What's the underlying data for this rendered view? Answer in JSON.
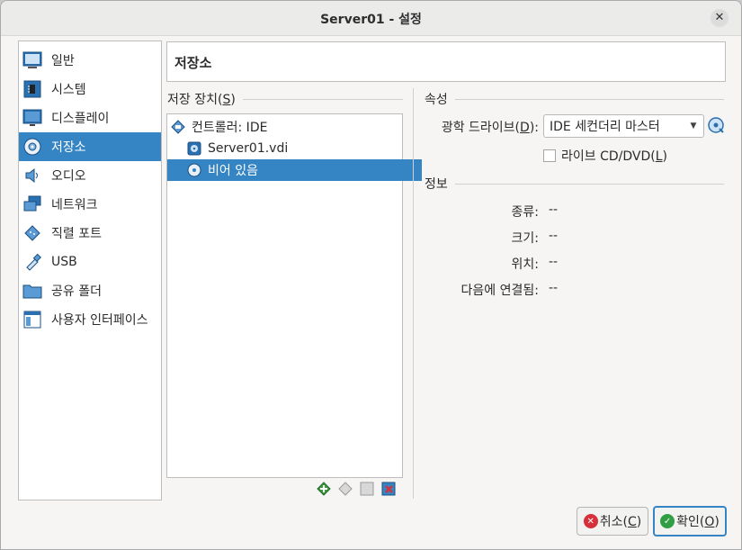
{
  "window": {
    "title": "Server01 - 설정"
  },
  "sidebar": {
    "items": [
      {
        "label": "일반",
        "icon": "general-icon"
      },
      {
        "label": "시스템",
        "icon": "system-icon"
      },
      {
        "label": "디스플레이",
        "icon": "display-icon"
      },
      {
        "label": "저장소",
        "icon": "storage-icon",
        "selected": true
      },
      {
        "label": "오디오",
        "icon": "audio-icon"
      },
      {
        "label": "네트워크",
        "icon": "network-icon"
      },
      {
        "label": "직렬 포트",
        "icon": "serial-port-icon"
      },
      {
        "label": "USB",
        "icon": "usb-icon"
      },
      {
        "label": "공유 폴더",
        "icon": "shared-folder-icon"
      },
      {
        "label": "사용자 인터페이스",
        "icon": "user-interface-icon"
      }
    ]
  },
  "page": {
    "title": "저장소"
  },
  "storage": {
    "header": "저장 장치(S)",
    "header_main": "저장 장치(",
    "header_key": "S",
    "header_end": ")",
    "tree": [
      {
        "label": "컨트롤러: IDE",
        "icon": "controller-icon"
      },
      {
        "label": "Server01.vdi",
        "icon": "hard-disk-icon"
      },
      {
        "label": "비어 있음",
        "icon": "optical-disc-icon",
        "selected": true
      }
    ]
  },
  "attributes": {
    "header": "속성",
    "drive_label_main": "광학 드라이브(",
    "drive_label_key": "D",
    "drive_label_end": "):",
    "drive_value": "IDE 세컨더리 마스터",
    "live_cd_main": "라이브 CD/DVD(",
    "live_cd_key": "L",
    "live_cd_end": ")",
    "live_cd_checked": false
  },
  "info": {
    "header": "정보",
    "rows": [
      {
        "label": "종류:",
        "value": "--"
      },
      {
        "label": "크기:",
        "value": "--"
      },
      {
        "label": "위치:",
        "value": "--"
      },
      {
        "label": "다음에 연결됨:",
        "value": "--"
      }
    ]
  },
  "buttons": {
    "cancel_main": "취소(",
    "cancel_key": "C",
    "cancel_end": ")",
    "ok_main": "확인(",
    "ok_key": "O",
    "ok_end": ")"
  },
  "colors": {
    "accent": "#3584c4",
    "cancel": "#d6303a",
    "ok": "#2f9e44"
  }
}
